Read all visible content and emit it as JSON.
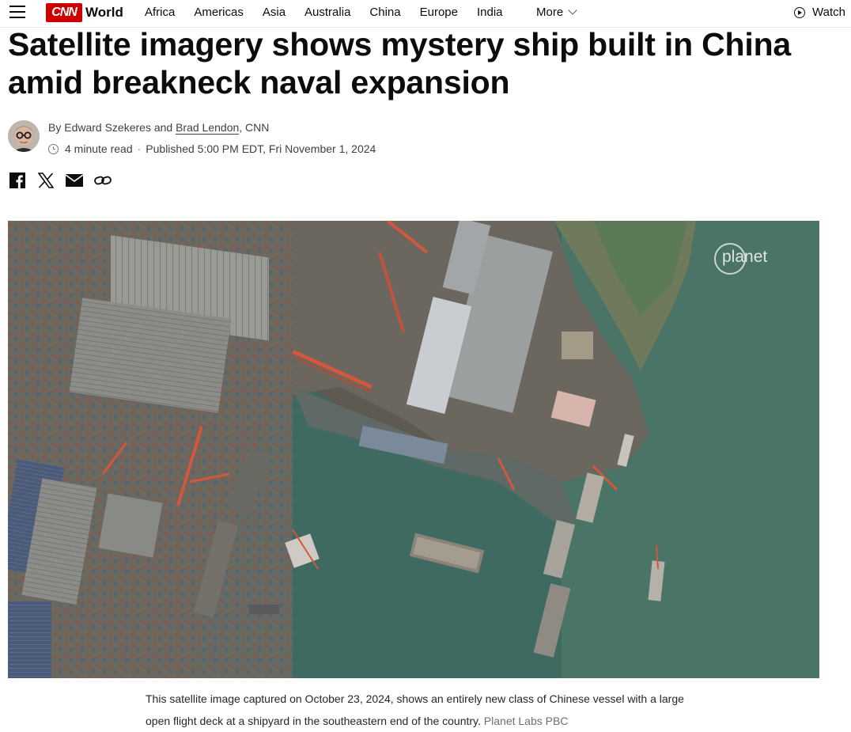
{
  "nav": {
    "brand": "CNN",
    "section": "World",
    "links": [
      "Africa",
      "Americas",
      "Asia",
      "Australia",
      "China",
      "Europe",
      "India"
    ],
    "more_label": "More",
    "watch_label": "Watch"
  },
  "article": {
    "headline": "Satellite imagery shows mystery ship built in China amid breakneck naval expansion",
    "byline_prefix": "By Edward Szekeres and",
    "byline_author_link": "Brad Lendon",
    "byline_suffix": ", CNN",
    "read_time": "4 minute read",
    "published": "Published 5:00 PM EDT, Fri November 1, 2024"
  },
  "share": {
    "icons": [
      "facebook-icon",
      "x-icon",
      "email-icon",
      "link-icon"
    ]
  },
  "image": {
    "watermark": "planet"
  },
  "caption": {
    "text": "This satellite image captured on October 23, 2024, shows an entirely new class of Chinese vessel with a large open flight deck at a shipyard in the southeastern end of the country.",
    "credit": "Planet Labs PBC"
  },
  "colors": {
    "brand_red": "#cc0000",
    "water": "#3f6a60",
    "text": "#0c0c0c"
  }
}
